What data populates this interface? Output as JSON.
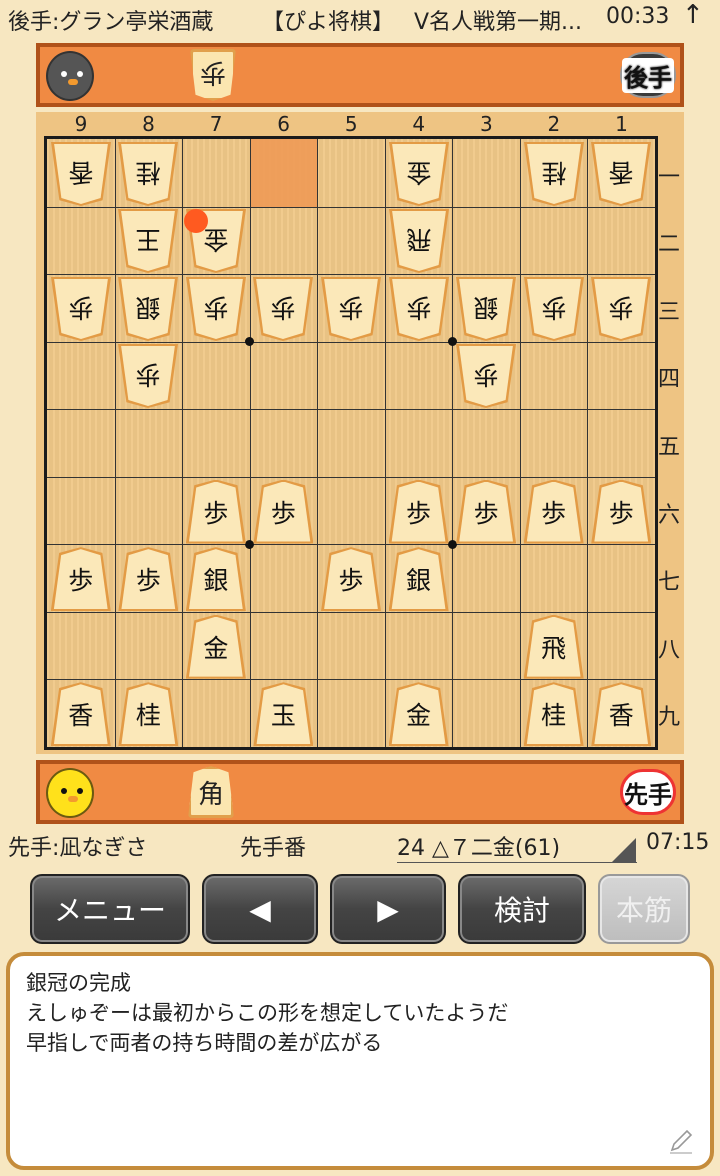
{
  "top": {
    "player": "後手:グラン亭栄酒蔵",
    "site": "【ぴよ将棋】",
    "event": "V名人戦第一期...",
    "clock": "00:33",
    "arrow": "↑"
  },
  "gote_stand": {
    "badge": "後手",
    "pieces": [
      "歩"
    ]
  },
  "sente_stand": {
    "badge": "先手",
    "pieces": [
      "角"
    ]
  },
  "board": {
    "file_labels": [
      "9",
      "8",
      "7",
      "6",
      "5",
      "4",
      "3",
      "2",
      "1"
    ],
    "rank_labels": [
      "一",
      "二",
      "三",
      "四",
      "五",
      "六",
      "七",
      "八",
      "九"
    ],
    "gote": [
      {
        "f": 9,
        "r": 1,
        "p": "香"
      },
      {
        "f": 8,
        "r": 1,
        "p": "桂"
      },
      {
        "f": 4,
        "r": 1,
        "p": "金"
      },
      {
        "f": 2,
        "r": 1,
        "p": "桂"
      },
      {
        "f": 1,
        "r": 1,
        "p": "香"
      },
      {
        "f": 8,
        "r": 2,
        "p": "王"
      },
      {
        "f": 7,
        "r": 2,
        "p": "金"
      },
      {
        "f": 4,
        "r": 2,
        "p": "飛"
      },
      {
        "f": 9,
        "r": 3,
        "p": "歩"
      },
      {
        "f": 8,
        "r": 3,
        "p": "銀"
      },
      {
        "f": 7,
        "r": 3,
        "p": "歩"
      },
      {
        "f": 6,
        "r": 3,
        "p": "歩"
      },
      {
        "f": 5,
        "r": 3,
        "p": "歩"
      },
      {
        "f": 4,
        "r": 3,
        "p": "歩"
      },
      {
        "f": 3,
        "r": 3,
        "p": "銀"
      },
      {
        "f": 2,
        "r": 3,
        "p": "歩"
      },
      {
        "f": 1,
        "r": 3,
        "p": "歩"
      },
      {
        "f": 8,
        "r": 4,
        "p": "歩"
      },
      {
        "f": 3,
        "r": 4,
        "p": "歩"
      }
    ],
    "sente": [
      {
        "f": 7,
        "r": 6,
        "p": "歩"
      },
      {
        "f": 6,
        "r": 6,
        "p": "歩"
      },
      {
        "f": 4,
        "r": 6,
        "p": "歩"
      },
      {
        "f": 3,
        "r": 6,
        "p": "歩"
      },
      {
        "f": 2,
        "r": 6,
        "p": "歩"
      },
      {
        "f": 1,
        "r": 6,
        "p": "歩"
      },
      {
        "f": 9,
        "r": 7,
        "p": "歩"
      },
      {
        "f": 8,
        "r": 7,
        "p": "歩"
      },
      {
        "f": 7,
        "r": 7,
        "p": "銀"
      },
      {
        "f": 5,
        "r": 7,
        "p": "歩"
      },
      {
        "f": 4,
        "r": 7,
        "p": "銀"
      },
      {
        "f": 7,
        "r": 8,
        "p": "金"
      },
      {
        "f": 2,
        "r": 8,
        "p": "飛"
      },
      {
        "f": 9,
        "r": 9,
        "p": "香"
      },
      {
        "f": 8,
        "r": 9,
        "p": "桂"
      },
      {
        "f": 6,
        "r": 9,
        "p": "玉"
      },
      {
        "f": 4,
        "r": 9,
        "p": "金"
      },
      {
        "f": 2,
        "r": 9,
        "p": "桂"
      },
      {
        "f": 1,
        "r": 9,
        "p": "香"
      }
    ],
    "highlight_from": {
      "f": 6,
      "r": 1
    },
    "last_move_marker": {
      "f": 7,
      "r": 2
    }
  },
  "status": {
    "sente_player": "先手:凪なぎさ",
    "turn": "先手番",
    "move": "24 △７二金(61)",
    "time": "07:15"
  },
  "buttons": {
    "menu": "メニュー",
    "prev": "◀",
    "next": "▶",
    "study": "検討",
    "main_line": "本筋"
  },
  "comment": {
    "lines": [
      "銀冠の完成",
      "えしゅぞーは最初からこの形を想定していたようだ",
      "早指しで両者の持ち時間の差が広がる"
    ]
  },
  "colors": {
    "stand": "#f08a43",
    "board": "#f0c888",
    "marker": "#ff5a20",
    "comment_border": "#c58c3b"
  }
}
